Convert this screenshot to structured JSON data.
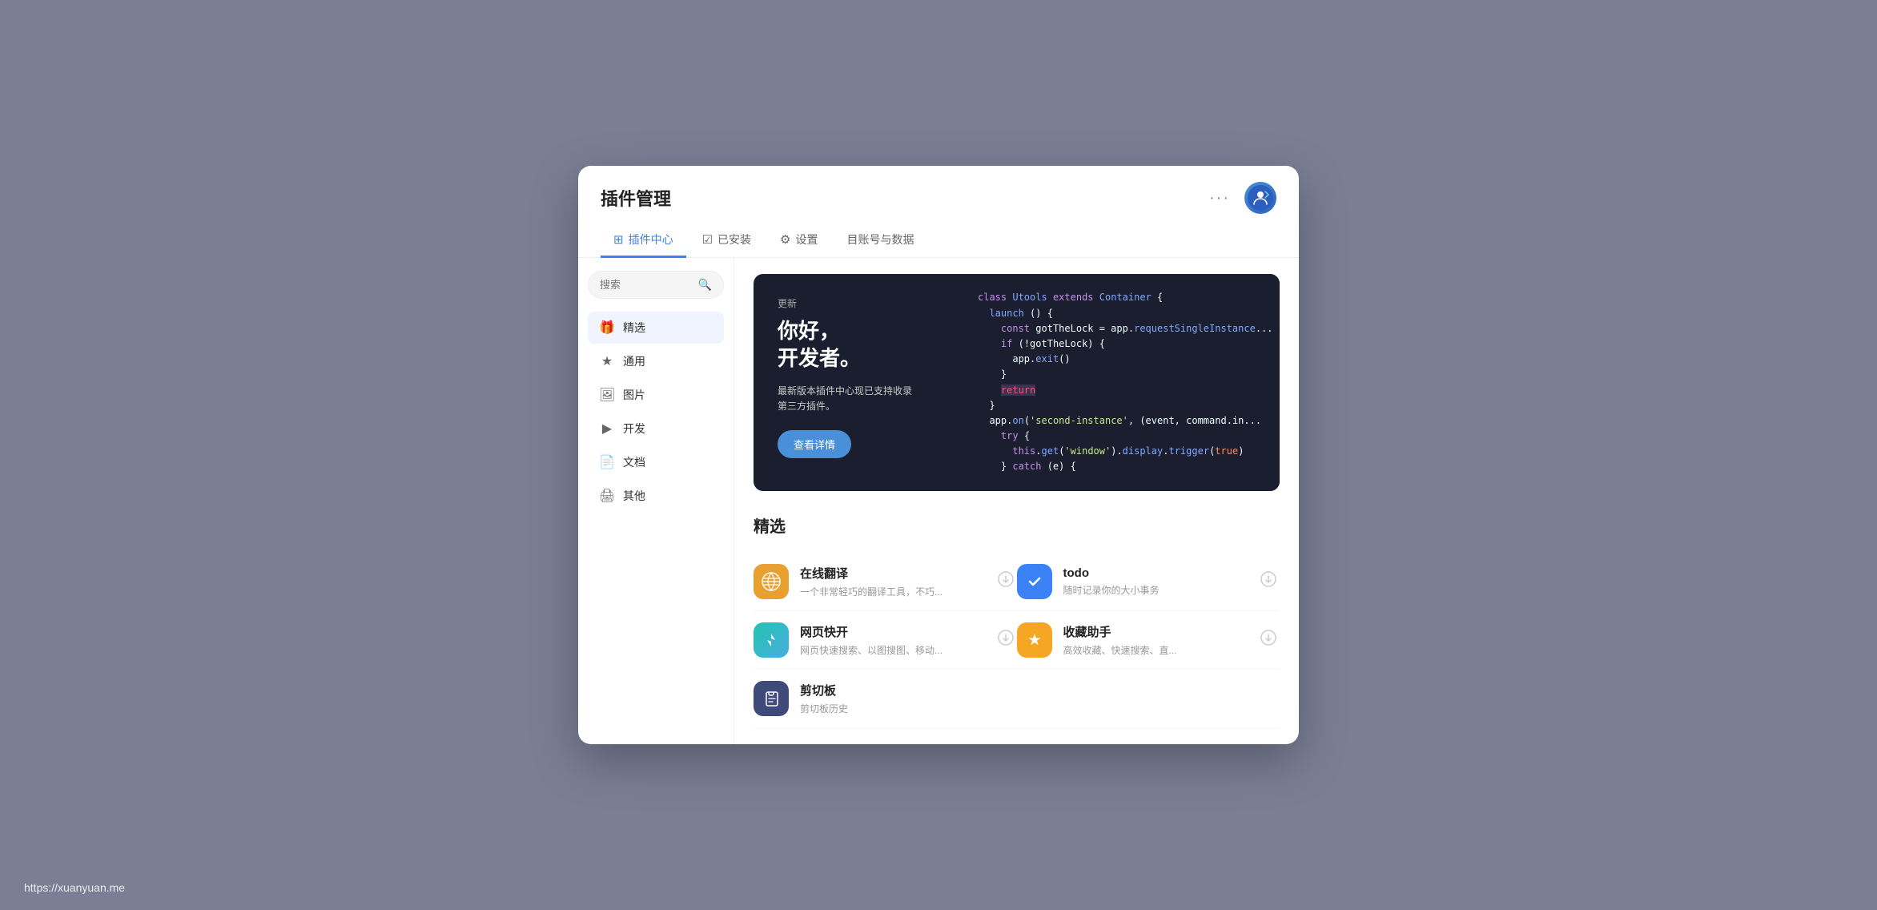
{
  "header": {
    "title": "插件管理",
    "dots_label": "···",
    "avatar_label": "用户头像"
  },
  "tabs": [
    {
      "id": "plugin-center",
      "icon": "⊞",
      "label": "插件中心",
      "active": true
    },
    {
      "id": "installed",
      "icon": "☑",
      "label": "已安装",
      "active": false
    },
    {
      "id": "settings",
      "icon": "⚙",
      "label": "设置",
      "active": false
    },
    {
      "id": "account",
      "icon": "",
      "label": "目账号与数据",
      "active": false
    }
  ],
  "search": {
    "placeholder": "搜索"
  },
  "sidebar": {
    "items": [
      {
        "id": "featured",
        "icon": "🎁",
        "label": "精选",
        "active": true
      },
      {
        "id": "general",
        "icon": "★",
        "label": "通用",
        "active": false
      },
      {
        "id": "image",
        "icon": "🖼",
        "label": "图片",
        "active": false
      },
      {
        "id": "dev",
        "icon": "▶",
        "label": "开发",
        "active": false
      },
      {
        "id": "docs",
        "icon": "📄",
        "label": "文档",
        "active": false
      },
      {
        "id": "other",
        "icon": "🖨",
        "label": "其他",
        "active": false
      }
    ]
  },
  "banner": {
    "tag": "更新",
    "title": "你好，\n开发者。",
    "desc": "最新版本插件中心现已支持收录\n第三方插件。",
    "button_label": "查看详情"
  },
  "section": {
    "title": "精选",
    "plugins": [
      {
        "id": "translate",
        "name": "在线翻译",
        "desc": "一个非常轻巧的翻译工具，不巧...",
        "icon_bg": "#e8a030",
        "icon": "🌐",
        "action": "download",
        "installed": false,
        "wide": false
      },
      {
        "id": "todo",
        "name": "todo",
        "desc": "随时记录你的大小事务",
        "icon_bg": "#3b82f6",
        "icon": "✓",
        "action": "download",
        "installed": true,
        "wide": false
      },
      {
        "id": "webopen",
        "name": "网页快开",
        "desc": "网页快速搜索、以图搜图、移动...",
        "icon_bg": "#22c4b0",
        "icon": "🚀",
        "action": "download",
        "installed": false,
        "wide": false
      },
      {
        "id": "bookmark",
        "name": "收藏助手",
        "desc": "高效收藏、快速搜索、直...",
        "icon_bg": "#f5a623",
        "icon": "★",
        "action": "download",
        "installed": false,
        "wide": false
      },
      {
        "id": "clipboard",
        "name": "剪切板",
        "desc": "剪切板历史",
        "icon_bg": "#3d4a7a",
        "icon": "📋",
        "action": "",
        "installed": false,
        "wide": true
      }
    ]
  },
  "watermark": "https://xuanyuan.me"
}
